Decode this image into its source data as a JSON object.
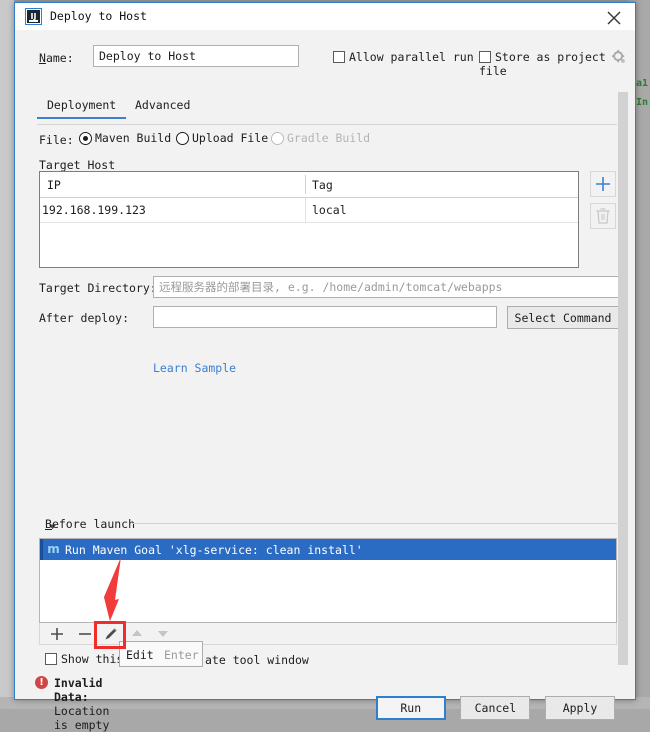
{
  "window": {
    "title": "Deploy to Host",
    "app_icon": "intellij-idea-icon",
    "close_icon": "close-icon"
  },
  "name_row": {
    "label": "Name:",
    "value": "Deploy to Host",
    "allow_parallel_run": "Allow parallel run",
    "store_as_project_file": "Store as project file",
    "gear_icon": "gear-icon"
  },
  "tabs": [
    {
      "label": "Deployment",
      "active": true
    },
    {
      "label": "Advanced",
      "active": false
    }
  ],
  "file_row": {
    "label": "File:",
    "options": [
      {
        "label": "Maven Build",
        "selected": true,
        "disabled": false
      },
      {
        "label": "Upload File",
        "selected": false,
        "disabled": false
      },
      {
        "label": "Gradle Build",
        "selected": false,
        "disabled": true
      }
    ]
  },
  "target_host": {
    "section_label": "Target Host",
    "columns": [
      "IP",
      "Tag"
    ],
    "rows": [
      {
        "ip": "192.168.199.123",
        "tag": "local"
      }
    ],
    "add_icon": "plus-icon",
    "delete_icon": "trash-icon"
  },
  "target_directory": {
    "label": "Target Directory:",
    "value": "",
    "placeholder": "远程服务器的部署目录, e.g. /home/admin/tomcat/webapps"
  },
  "after_deploy": {
    "label": "After deploy:",
    "value": "",
    "placeholder": "",
    "select_command_label": "Select Command",
    "learn_sample_label": "Learn Sample"
  },
  "before_launch": {
    "header": "Before launch",
    "collapse_icon": "chevron-down-icon",
    "items": [
      {
        "icon": "maven-icon",
        "label": "Run Maven Goal 'xlg-service: clean install'",
        "selected": true
      }
    ],
    "toolbar": {
      "add_icon": "plus-icon",
      "remove_icon": "minus-icon",
      "edit_icon": "pencil-icon",
      "move_up_icon": "arrow-up-icon",
      "move_down_icon": "arrow-down-icon"
    },
    "tooltip": {
      "action": "Edit",
      "shortcut": "Enter"
    },
    "show_page_checkbox": {
      "prefix": "Show this",
      "suffix": "ate tool window"
    }
  },
  "status": {
    "icon": "error-icon",
    "prefix": "Invalid Data:",
    "message": "Location is empty"
  },
  "footer_buttons": [
    {
      "label": "Run",
      "primary": true
    },
    {
      "label": "Cancel",
      "primary": false
    },
    {
      "label": "Apply",
      "primary": false
    }
  ],
  "background": {
    "code_line_1": "a1",
    "code_line_2": "In"
  },
  "colors": {
    "accent": "#2f7fd0",
    "selection": "#2a6cc4",
    "link": "#3b7fd4",
    "error": "#cf4646",
    "annotation": "#ef2d2d"
  }
}
